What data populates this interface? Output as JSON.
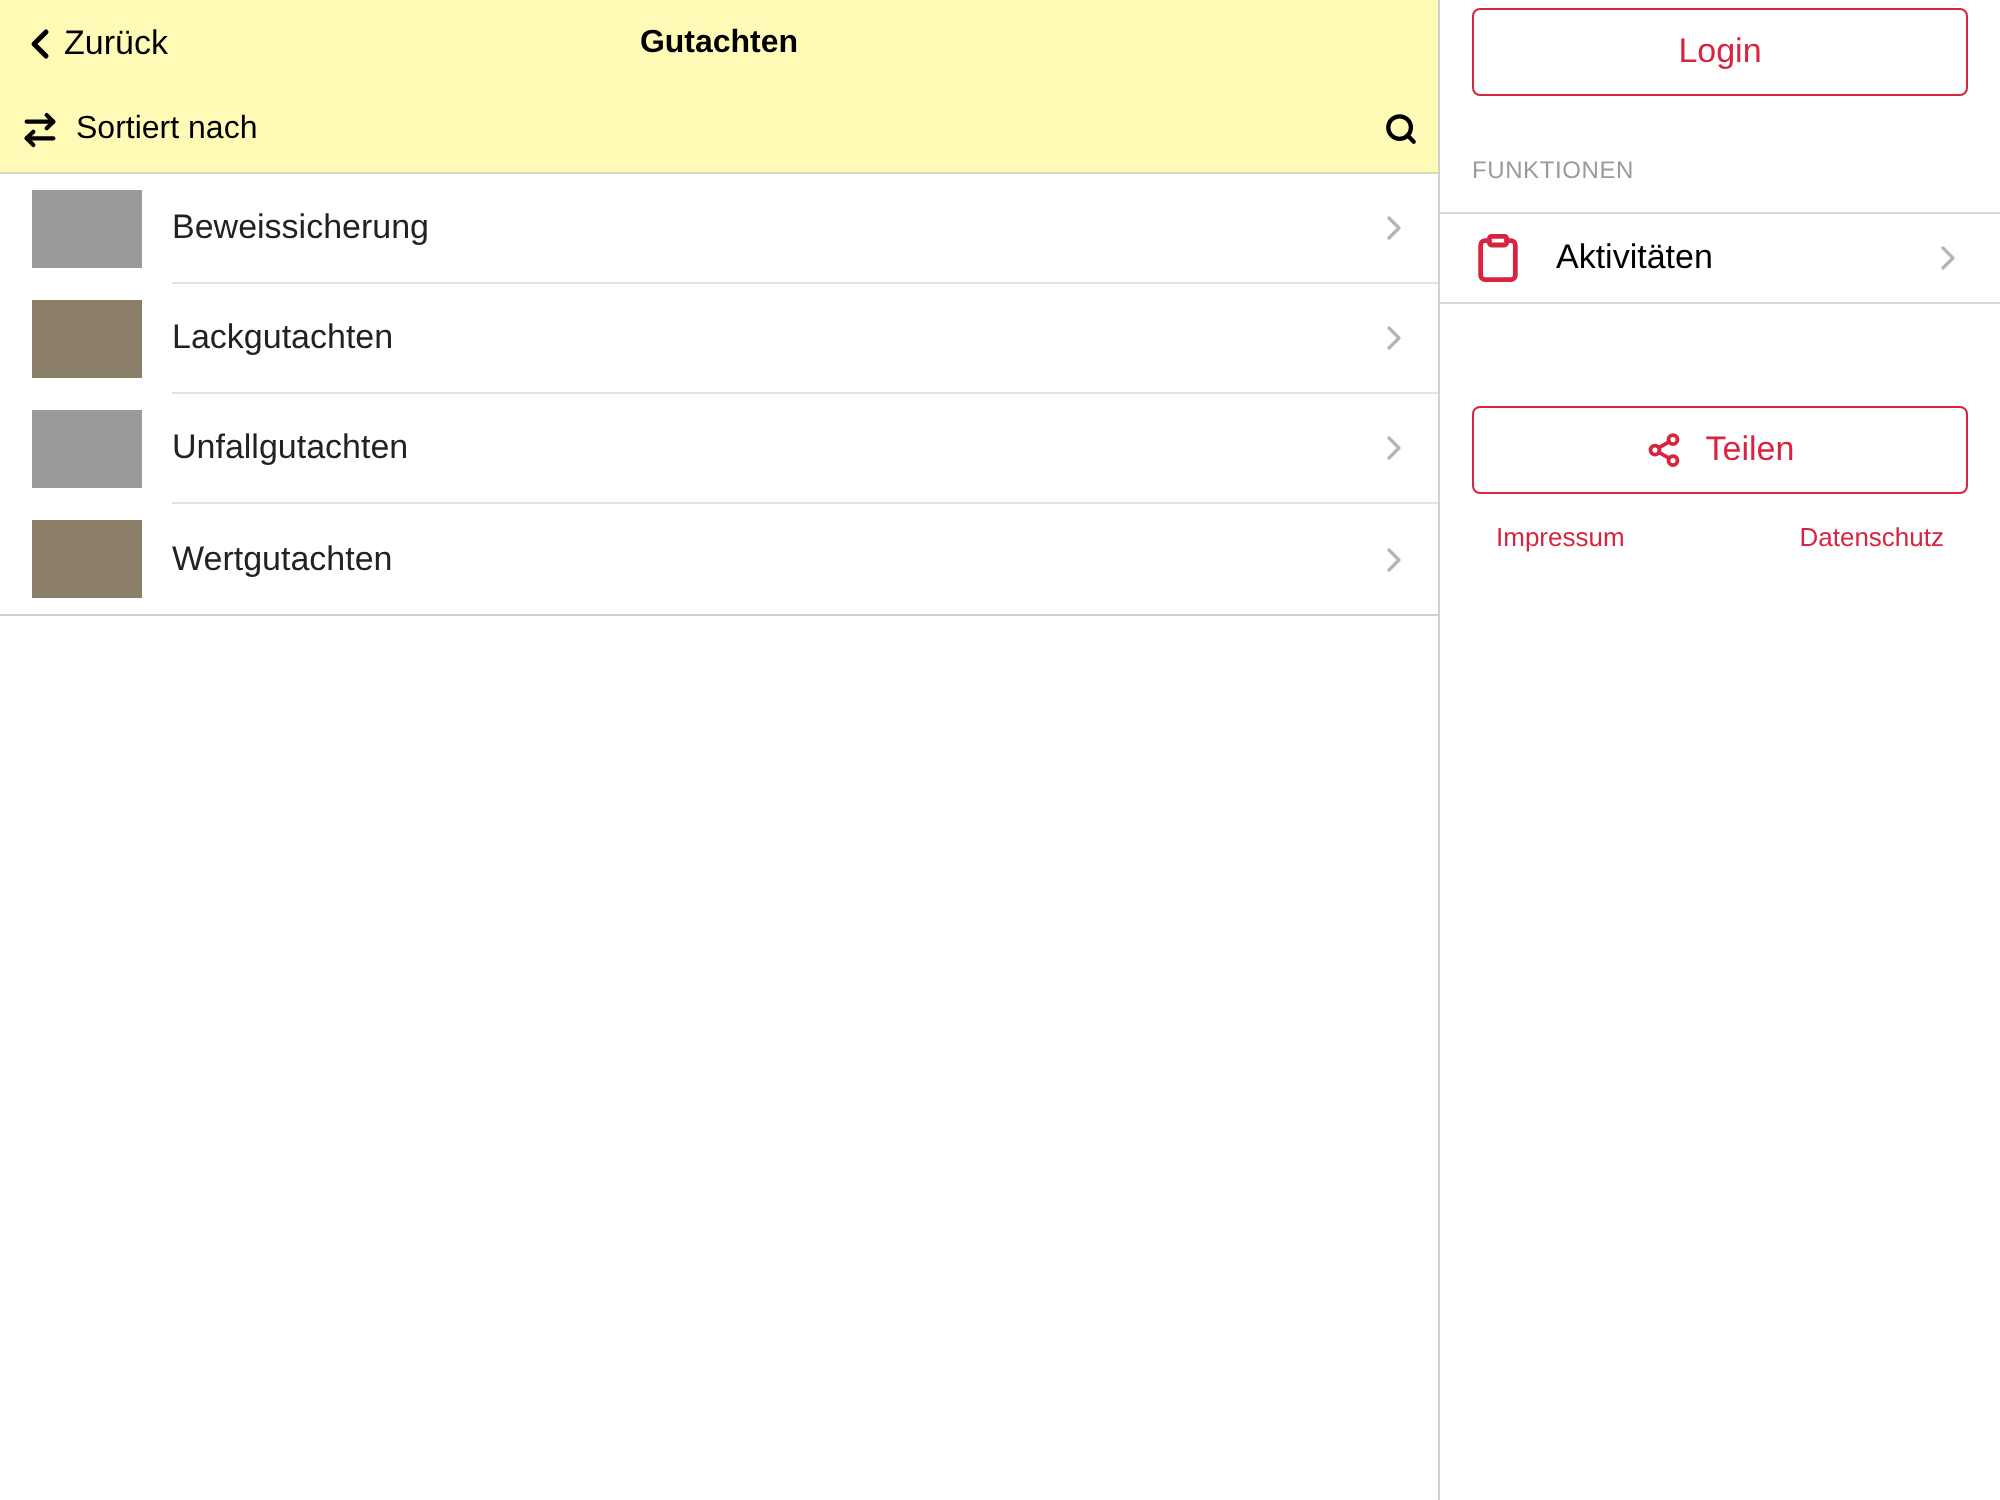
{
  "nav_bar": {
    "back": "Zurück",
    "title": "Gutachten"
  },
  "sort_bar": {
    "label": "Sortiert nach"
  },
  "list": [
    {
      "label": "Beweissicherung"
    },
    {
      "label": "Lackgutachten"
    },
    {
      "label": "Unfallgutachten"
    },
    {
      "label": "Wertgutachten"
    }
  ],
  "sidebar": {
    "login": "Login",
    "section": "FUNKTIONEN",
    "items": [
      {
        "label": "Aktivitäten"
      }
    ],
    "share": "Teilen",
    "links": [
      "Impressum",
      "Datenschutz"
    ]
  }
}
